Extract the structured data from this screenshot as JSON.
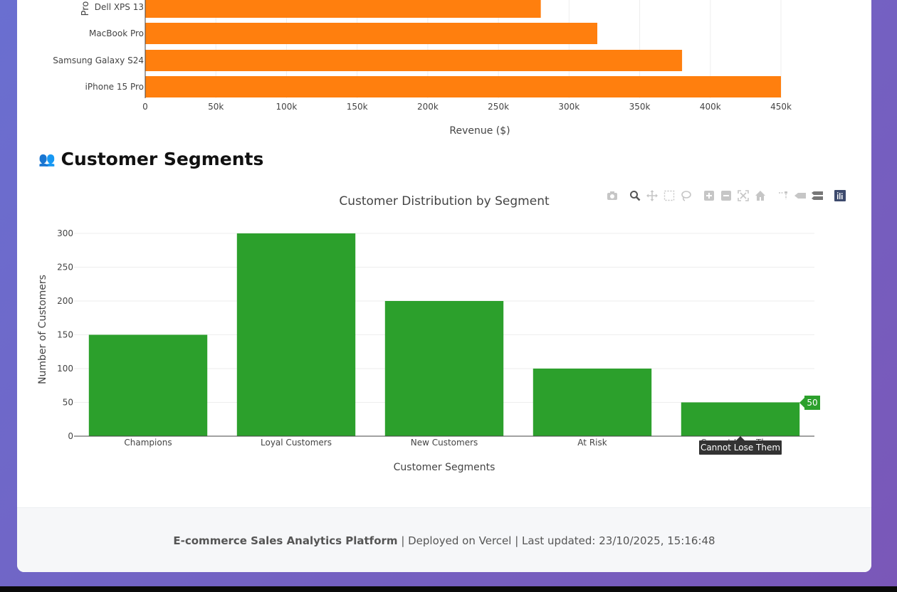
{
  "top_chart": {
    "xlabel": "Revenue ($)",
    "ylabel_partial": "Pro"
  },
  "segments_section": {
    "icon": "people-icon",
    "emoji": "👥",
    "heading": "Customer Segments"
  },
  "modebar": {
    "buttons": [
      "camera-icon",
      "zoom-icon",
      "pan-icon",
      "box-select-icon",
      "lasso-select-icon",
      "zoom-in-icon",
      "zoom-out-icon",
      "autoscale-icon",
      "reset-axes-icon",
      "spike-lines-icon",
      "hover-closest-icon",
      "hover-compare-icon",
      "plotly-logo-icon"
    ]
  },
  "hover": {
    "value_label": "50",
    "category_label": "Cannot Lose Them"
  },
  "footer": {
    "app_name": "E-commerce Sales Analytics Platform",
    "rest": " | Deployed on Vercel | Last updated: 23/10/2025, 15:16:48"
  },
  "chart_data": [
    {
      "type": "bar",
      "orientation": "horizontal",
      "categories": [
        "iPhone 15 Pro",
        "Samsung Galaxy S24",
        "MacBook Pro",
        "Dell XPS 13"
      ],
      "values": [
        450000,
        380000,
        320000,
        280000
      ],
      "xlabel": "Revenue ($)",
      "ylabel": "",
      "xlim": [
        0,
        450000
      ],
      "xticks": [
        "0",
        "50k",
        "100k",
        "150k",
        "200k",
        "250k",
        "300k",
        "350k",
        "400k",
        "450k"
      ],
      "color": "#ff7f0e",
      "grid": true
    },
    {
      "type": "bar",
      "title": "Customer Distribution by Segment",
      "categories": [
        "Champions",
        "Loyal Customers",
        "New Customers",
        "At Risk",
        "Cannot Lose Them"
      ],
      "values": [
        150,
        300,
        200,
        100,
        50
      ],
      "xlabel": "Customer Segments",
      "ylabel": "Number of Customers",
      "ylim": [
        0,
        300
      ],
      "yticks": [
        "0",
        "50",
        "100",
        "150",
        "200",
        "250",
        "300"
      ],
      "color": "#2ca02c",
      "grid": true
    }
  ]
}
